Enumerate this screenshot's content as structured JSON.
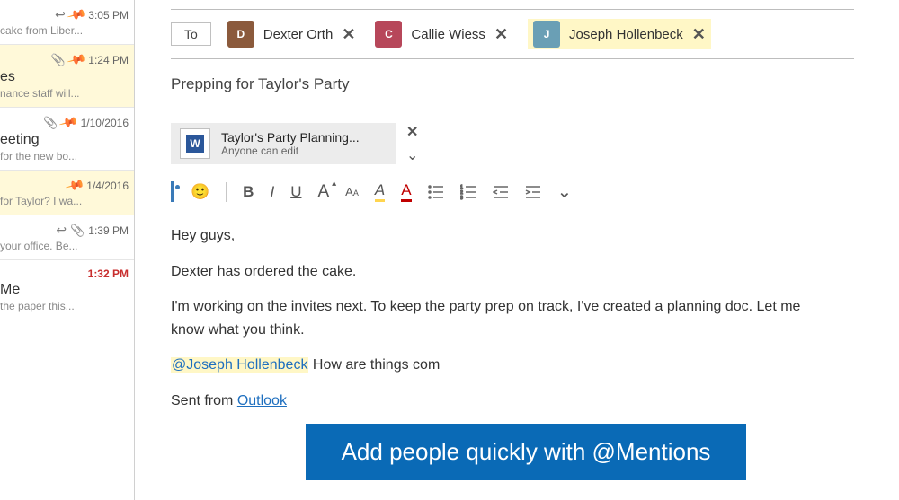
{
  "msg_list": [
    {
      "time": "3:05 PM",
      "preview": "cake from Liber...",
      "title": "",
      "icons": [
        "reply",
        "pin"
      ],
      "yellow": false
    },
    {
      "time": "1:24 PM",
      "preview": "nance staff will...",
      "title": "es",
      "icons": [
        "clip",
        "pin"
      ],
      "yellow": true
    },
    {
      "time": "1/10/2016",
      "preview": "for the new bo...",
      "title": "eeting",
      "icons": [
        "clip",
        "pin"
      ],
      "yellow": false
    },
    {
      "time": "1/4/2016",
      "preview": "for Taylor? I wa...",
      "title": "",
      "icons": [
        "pin"
      ],
      "yellow": true
    },
    {
      "time": "1:39 PM",
      "preview": "your office. Be...",
      "title": "",
      "icons": [
        "reply",
        "clip"
      ],
      "yellow": false
    },
    {
      "time": "1:32 PM",
      "preview": "the paper this...",
      "title": "Me",
      "time_red": true,
      "icons": [],
      "yellow": false
    }
  ],
  "to_label": "To",
  "recipients": [
    {
      "name": "Dexter Orth",
      "initial": "D",
      "av": "av1",
      "hl": false
    },
    {
      "name": "Callie Wiess",
      "initial": "C",
      "av": "av2",
      "hl": false
    },
    {
      "name": "Joseph Hollenbeck",
      "initial": "J",
      "av": "av3",
      "hl": true
    }
  ],
  "subject": "Prepping for Taylor's Party",
  "attachment": {
    "name": "Taylor's Party Planning...",
    "perm": "Anyone can edit"
  },
  "body": {
    "p1": "Hey guys,",
    "p2": "Dexter has ordered the cake.",
    "p3": "I'm working on the invites next. To keep the party prep on track, I've created a planning doc. Let me know what you think.",
    "mention": "@Joseph Hollenbeck",
    "p4_rest": " How are things com",
    "sent_prefix": "Sent from ",
    "sent_link": "Outlook"
  },
  "banner": "Add people quickly with @Mentions",
  "toolbar": {
    "bold": "B",
    "italic": "I",
    "underline": "U",
    "size_plus": "A",
    "size_minus": "A",
    "chev": "⌄"
  }
}
